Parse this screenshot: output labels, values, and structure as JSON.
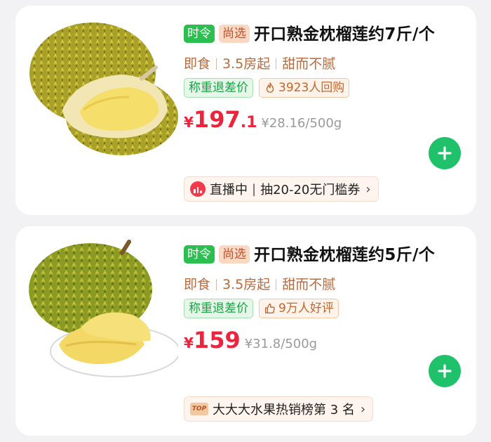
{
  "products": [
    {
      "tags": [
        "时令",
        "尚选"
      ],
      "title": "开口熟金枕榴莲约7斤/个",
      "attrs": [
        "即食",
        "3.5房起",
        "甜而不腻"
      ],
      "badge_weight": "称重退差价",
      "badge_social": "3923人回购",
      "badge_social_icon": "flame-icon",
      "price_symbol": "¥",
      "price_int": "197",
      "price_dec": ".1",
      "unit_price": "¥28.16/500g",
      "promo_icon": "live-icon",
      "promo_text_a": "直播中",
      "promo_sep": "|",
      "promo_text_b": "抽20-20无门槛券",
      "promo_chevron": "›"
    },
    {
      "tags": [
        "时令",
        "尚选"
      ],
      "title": "开口熟金枕榴莲约5斤/个",
      "attrs": [
        "即食",
        "3.5房起",
        "甜而不腻"
      ],
      "badge_weight": "称重退差价",
      "badge_social": "9万人好评",
      "badge_social_icon": "thumbs-up-icon",
      "price_symbol": "¥",
      "price_int": "159",
      "price_dec": "",
      "unit_price": "¥31.8/500g",
      "promo_icon": "top-rank-icon",
      "promo_icon_text": "TOP",
      "promo_text_a": "大大大水果热销榜第 3 名",
      "promo_chevron": "›"
    }
  ],
  "colors": {
    "accent_green": "#1fc16b",
    "price_red": "#f0233c",
    "tag_green": "#2bbf4f",
    "tag_peach": "#fbd8c2"
  }
}
